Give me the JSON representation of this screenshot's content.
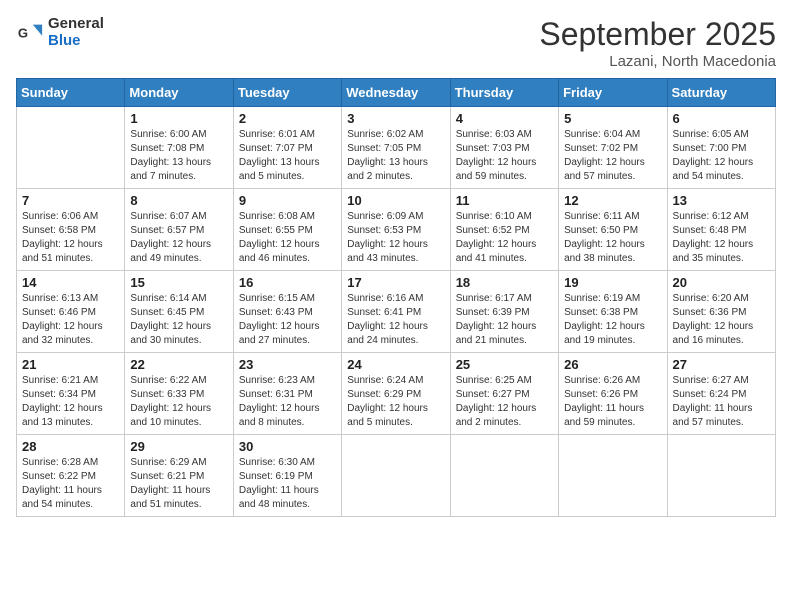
{
  "header": {
    "logo_general": "General",
    "logo_blue": "Blue",
    "title": "September 2025",
    "subtitle": "Lazani, North Macedonia"
  },
  "days_of_week": [
    "Sunday",
    "Monday",
    "Tuesday",
    "Wednesday",
    "Thursday",
    "Friday",
    "Saturday"
  ],
  "weeks": [
    [
      {
        "day": "",
        "info": ""
      },
      {
        "day": "1",
        "info": "Sunrise: 6:00 AM\nSunset: 7:08 PM\nDaylight: 13 hours\nand 7 minutes."
      },
      {
        "day": "2",
        "info": "Sunrise: 6:01 AM\nSunset: 7:07 PM\nDaylight: 13 hours\nand 5 minutes."
      },
      {
        "day": "3",
        "info": "Sunrise: 6:02 AM\nSunset: 7:05 PM\nDaylight: 13 hours\nand 2 minutes."
      },
      {
        "day": "4",
        "info": "Sunrise: 6:03 AM\nSunset: 7:03 PM\nDaylight: 12 hours\nand 59 minutes."
      },
      {
        "day": "5",
        "info": "Sunrise: 6:04 AM\nSunset: 7:02 PM\nDaylight: 12 hours\nand 57 minutes."
      },
      {
        "day": "6",
        "info": "Sunrise: 6:05 AM\nSunset: 7:00 PM\nDaylight: 12 hours\nand 54 minutes."
      }
    ],
    [
      {
        "day": "7",
        "info": "Sunrise: 6:06 AM\nSunset: 6:58 PM\nDaylight: 12 hours\nand 51 minutes."
      },
      {
        "day": "8",
        "info": "Sunrise: 6:07 AM\nSunset: 6:57 PM\nDaylight: 12 hours\nand 49 minutes."
      },
      {
        "day": "9",
        "info": "Sunrise: 6:08 AM\nSunset: 6:55 PM\nDaylight: 12 hours\nand 46 minutes."
      },
      {
        "day": "10",
        "info": "Sunrise: 6:09 AM\nSunset: 6:53 PM\nDaylight: 12 hours\nand 43 minutes."
      },
      {
        "day": "11",
        "info": "Sunrise: 6:10 AM\nSunset: 6:52 PM\nDaylight: 12 hours\nand 41 minutes."
      },
      {
        "day": "12",
        "info": "Sunrise: 6:11 AM\nSunset: 6:50 PM\nDaylight: 12 hours\nand 38 minutes."
      },
      {
        "day": "13",
        "info": "Sunrise: 6:12 AM\nSunset: 6:48 PM\nDaylight: 12 hours\nand 35 minutes."
      }
    ],
    [
      {
        "day": "14",
        "info": "Sunrise: 6:13 AM\nSunset: 6:46 PM\nDaylight: 12 hours\nand 32 minutes."
      },
      {
        "day": "15",
        "info": "Sunrise: 6:14 AM\nSunset: 6:45 PM\nDaylight: 12 hours\nand 30 minutes."
      },
      {
        "day": "16",
        "info": "Sunrise: 6:15 AM\nSunset: 6:43 PM\nDaylight: 12 hours\nand 27 minutes."
      },
      {
        "day": "17",
        "info": "Sunrise: 6:16 AM\nSunset: 6:41 PM\nDaylight: 12 hours\nand 24 minutes."
      },
      {
        "day": "18",
        "info": "Sunrise: 6:17 AM\nSunset: 6:39 PM\nDaylight: 12 hours\nand 21 minutes."
      },
      {
        "day": "19",
        "info": "Sunrise: 6:19 AM\nSunset: 6:38 PM\nDaylight: 12 hours\nand 19 minutes."
      },
      {
        "day": "20",
        "info": "Sunrise: 6:20 AM\nSunset: 6:36 PM\nDaylight: 12 hours\nand 16 minutes."
      }
    ],
    [
      {
        "day": "21",
        "info": "Sunrise: 6:21 AM\nSunset: 6:34 PM\nDaylight: 12 hours\nand 13 minutes."
      },
      {
        "day": "22",
        "info": "Sunrise: 6:22 AM\nSunset: 6:33 PM\nDaylight: 12 hours\nand 10 minutes."
      },
      {
        "day": "23",
        "info": "Sunrise: 6:23 AM\nSunset: 6:31 PM\nDaylight: 12 hours\nand 8 minutes."
      },
      {
        "day": "24",
        "info": "Sunrise: 6:24 AM\nSunset: 6:29 PM\nDaylight: 12 hours\nand 5 minutes."
      },
      {
        "day": "25",
        "info": "Sunrise: 6:25 AM\nSunset: 6:27 PM\nDaylight: 12 hours\nand 2 minutes."
      },
      {
        "day": "26",
        "info": "Sunrise: 6:26 AM\nSunset: 6:26 PM\nDaylight: 11 hours\nand 59 minutes."
      },
      {
        "day": "27",
        "info": "Sunrise: 6:27 AM\nSunset: 6:24 PM\nDaylight: 11 hours\nand 57 minutes."
      }
    ],
    [
      {
        "day": "28",
        "info": "Sunrise: 6:28 AM\nSunset: 6:22 PM\nDaylight: 11 hours\nand 54 minutes."
      },
      {
        "day": "29",
        "info": "Sunrise: 6:29 AM\nSunset: 6:21 PM\nDaylight: 11 hours\nand 51 minutes."
      },
      {
        "day": "30",
        "info": "Sunrise: 6:30 AM\nSunset: 6:19 PM\nDaylight: 11 hours\nand 48 minutes."
      },
      {
        "day": "",
        "info": ""
      },
      {
        "day": "",
        "info": ""
      },
      {
        "day": "",
        "info": ""
      },
      {
        "day": "",
        "info": ""
      }
    ]
  ]
}
